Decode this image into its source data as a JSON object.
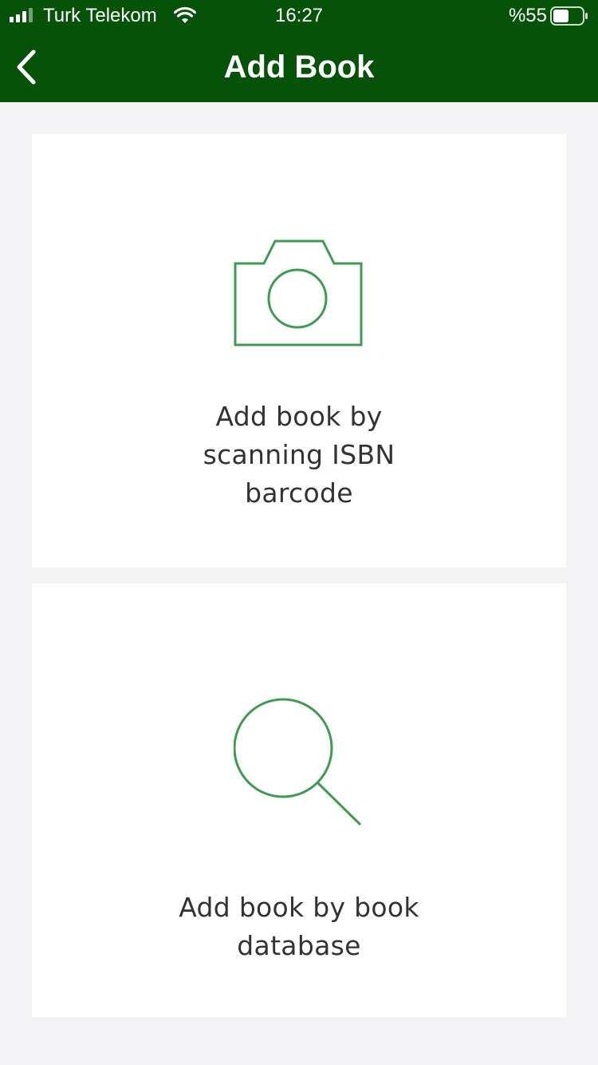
{
  "status_bar": {
    "carrier": "Turk Telekom",
    "time": "16:27",
    "battery_percent": "%55",
    "signal_icon": "cellular-signal-icon",
    "wifi_icon": "wifi-icon",
    "battery_icon": "battery-icon"
  },
  "header": {
    "title": "Add Book",
    "back_icon": "chevron-left-icon",
    "background_color": "#075209"
  },
  "options": [
    {
      "icon": "camera-icon",
      "label": "Add book by scanning ISBN barcode"
    },
    {
      "icon": "search-icon",
      "label": "Add book by book database"
    }
  ],
  "colors": {
    "accent": "#3f9b52",
    "background": "#f4f4f6",
    "card": "#ffffff",
    "text": "#333333"
  }
}
